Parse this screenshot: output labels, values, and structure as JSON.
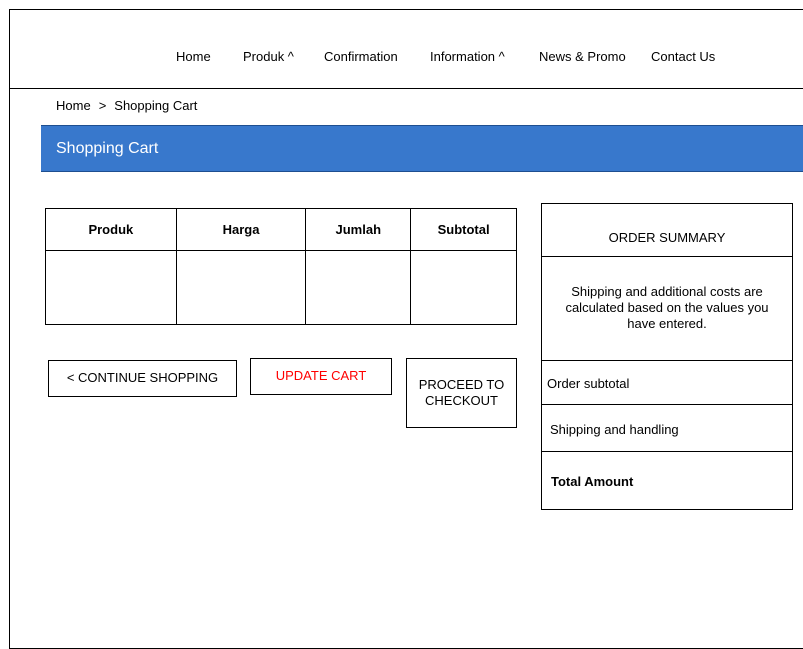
{
  "nav": {
    "items": [
      "Home",
      "Produk ^",
      "Confirmation",
      "Information ^",
      "News & Promo",
      "Contact Us"
    ]
  },
  "breadcrumb": {
    "home": "Home",
    "separator": ">",
    "current": "Shopping Cart"
  },
  "page": {
    "title": "Shopping Cart"
  },
  "cart_table": {
    "headers": [
      "Produk",
      "Harga",
      "Jumlah",
      "Subtotal"
    ]
  },
  "buttons": {
    "continue": "< CONTINUE SHOPPING",
    "update": "UPDATE CART",
    "checkout": "PROCEED TO CHECKOUT"
  },
  "summary": {
    "heading": "ORDER SUMMARY",
    "note": "Shipping and additional costs are calculated based on the values you have entered.",
    "subtotal_label": "Order subtotal",
    "shipping_label": "Shipping and handling",
    "total_label": "Total Amount"
  },
  "colors": {
    "title_bar": "#3878CC",
    "update_text": "#FF0000"
  }
}
